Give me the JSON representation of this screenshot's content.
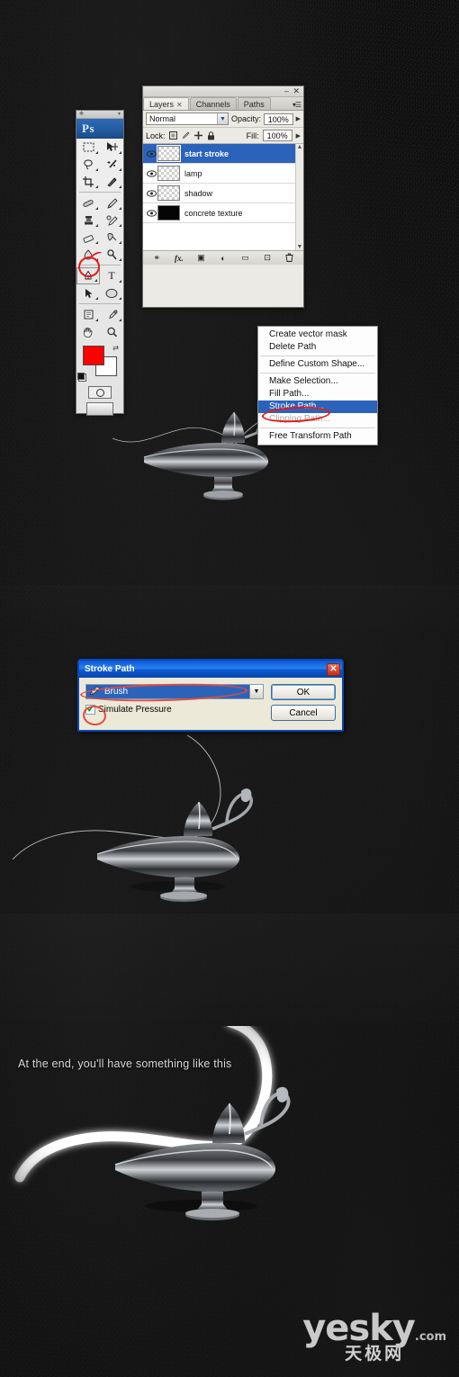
{
  "tutorial": {
    "caption": "At the end, you'll have something like this",
    "watermark": {
      "name": "yesky",
      "tld": ".com",
      "cn": "天极网"
    }
  },
  "toolbar": {
    "logo": "Ps",
    "tools": [
      {
        "name": "marquee-tool",
        "glyph": "▭"
      },
      {
        "name": "move-tool",
        "glyph": "✥"
      },
      {
        "name": "lasso-tool",
        "glyph": "◠"
      },
      {
        "name": "magic-wand-tool",
        "glyph": "✳"
      },
      {
        "name": "crop-tool",
        "glyph": "⌗"
      },
      {
        "name": "slice-tool",
        "glyph": "✂"
      },
      {
        "name": "healing-brush-tool",
        "glyph": "⟋"
      },
      {
        "name": "brush-tool",
        "glyph": "🖌"
      },
      {
        "name": "clone-stamp-tool",
        "glyph": "⚒"
      },
      {
        "name": "history-brush-tool",
        "glyph": "↺"
      },
      {
        "name": "eraser-tool",
        "glyph": "◰"
      },
      {
        "name": "gradient-tool",
        "glyph": "▰"
      },
      {
        "name": "blur-tool",
        "glyph": "◍"
      },
      {
        "name": "dodge-tool",
        "glyph": "✋"
      },
      {
        "name": "pen-tool",
        "glyph": "✒"
      },
      {
        "name": "type-tool",
        "glyph": "T"
      },
      {
        "name": "path-selection-tool",
        "glyph": "➤"
      },
      {
        "name": "ellipse-shape-tool",
        "glyph": "⬭"
      },
      {
        "name": "notes-tool",
        "glyph": "🗒"
      },
      {
        "name": "eyedropper-tool",
        "glyph": "⌖"
      },
      {
        "name": "hand-tool",
        "glyph": "✋"
      },
      {
        "name": "zoom-tool",
        "glyph": "🔍"
      }
    ],
    "foreground_color": "#fe0000",
    "background_color": "#ffffff",
    "selected_tool": "pen-tool"
  },
  "layers_panel": {
    "tabs": [
      {
        "label": "Layers",
        "active": true,
        "closable": true
      },
      {
        "label": "Channels",
        "active": false,
        "closable": false
      },
      {
        "label": "Paths",
        "active": false,
        "closable": false
      }
    ],
    "blend_mode": "Normal",
    "opacity_label": "Opacity:",
    "opacity_value": "100%",
    "lock_label": "Lock:",
    "fill_label": "Fill:",
    "fill_value": "100%",
    "layers": [
      {
        "name": "start stroke",
        "visible": true,
        "selected": true,
        "thumb": "transparent"
      },
      {
        "name": "lamp",
        "visible": true,
        "selected": false,
        "thumb": "transparent"
      },
      {
        "name": "shadow",
        "visible": true,
        "selected": false,
        "thumb": "transparent"
      },
      {
        "name": "concrete texture",
        "visible": true,
        "selected": false,
        "thumb": "black"
      }
    ],
    "bottom_buttons": [
      {
        "name": "link-layers-button",
        "glyph": "⚭"
      },
      {
        "name": "layer-style-button",
        "glyph": "fx."
      },
      {
        "name": "layer-mask-button",
        "glyph": "▣"
      },
      {
        "name": "adjustment-layer-button",
        "glyph": "◐"
      },
      {
        "name": "new-group-button",
        "glyph": "▭"
      },
      {
        "name": "new-layer-button",
        "glyph": "⊡"
      },
      {
        "name": "delete-layer-button",
        "glyph": "🗑"
      }
    ]
  },
  "context_menu": {
    "items": [
      {
        "label": "Create vector mask",
        "state": "normal"
      },
      {
        "label": "Delete Path",
        "state": "normal"
      },
      {
        "sep": true
      },
      {
        "label": "Define Custom Shape...",
        "state": "normal"
      },
      {
        "sep": true
      },
      {
        "label": "Make Selection...",
        "state": "normal"
      },
      {
        "label": "Fill Path...",
        "state": "normal"
      },
      {
        "label": "Stroke Path...",
        "state": "highlighted"
      },
      {
        "label": "Clipping Path...",
        "state": "disabled"
      },
      {
        "sep": true
      },
      {
        "label": "Free Transform Path",
        "state": "normal"
      }
    ]
  },
  "stroke_dialog": {
    "title": "Stroke Path",
    "close_glyph": "✕",
    "tool_value": "Brush",
    "checkbox_label": "Simulate Pressure",
    "checkbox_checked": true,
    "check_glyph": "✔",
    "ok_label": "OK",
    "cancel_label": "Cancel"
  },
  "colors": {
    "highlight_blue": "#2b63ba",
    "annotation_red": "#e21b1b",
    "titlebar_blue": "#0a58d8",
    "background": "#121212"
  }
}
